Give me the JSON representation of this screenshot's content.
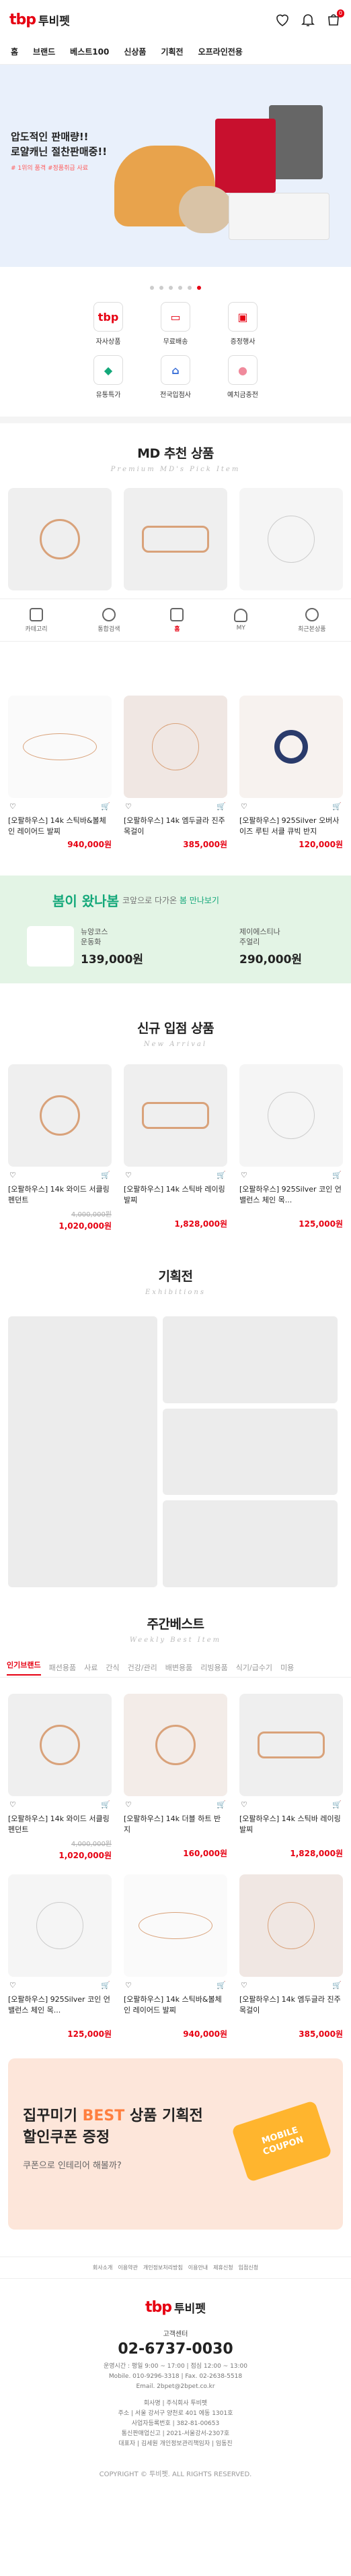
{
  "header": {
    "logo_mark": "tbp",
    "logo_text": "투비펫",
    "cart_count": "0"
  },
  "gnb": [
    "홈",
    "브랜드",
    "베스트100",
    "신상품",
    "기획전",
    "오프라인전용"
  ],
  "banner": {
    "line1": "압도적인 판매량!!",
    "line2": "로얄캐닌 절찬판매중!!",
    "tags": "# 1위의 품격 #정품취급 사료"
  },
  "quick": [
    {
      "label": "자사상품",
      "icon": "tbp-icon"
    },
    {
      "label": "무료배송",
      "icon": "truck-icon"
    },
    {
      "label": "증정행사",
      "icon": "gift-icon"
    },
    {
      "label": "유통특가",
      "icon": "tag-icon"
    },
    {
      "label": "전국입점사",
      "icon": "store-icon"
    },
    {
      "label": "예치금충전",
      "icon": "piggy-icon"
    }
  ],
  "md": {
    "title": "MD 추천 상품",
    "sub": "Premium MD's Pick Item"
  },
  "md_products": [
    {
      "name": "",
      "price": ""
    },
    {
      "name": "",
      "price": ""
    },
    {
      "name": "",
      "price": ""
    },
    {
      "name": "[오팔하우스] 14k 스틱바&볼체인 레이어드 발찌",
      "price": "940,000원"
    },
    {
      "name": "[오팔하우스] 14k 엠두글라 진주 목걸이",
      "price": "385,000원"
    },
    {
      "name": "[오팔하우스] 925Silver 오버사이즈 루틴 서클 큐빅 반지",
      "price": "120,000원"
    }
  ],
  "bottom_nav": [
    "카테고리",
    "통합검색",
    "홈",
    "MY",
    "최근본상품"
  ],
  "spring": {
    "title": "봄이 왔나봄",
    "sub_pre": "코앞으로 다가온 ",
    "sub_hl": "봄 만나보기",
    "items": [
      {
        "name": "뉴앙코스\n운동화",
        "price": "139,000원"
      },
      {
        "name": "제이에스티나\n주얼리",
        "price": "290,000원"
      }
    ]
  },
  "new": {
    "title": "신규 입점 상품",
    "sub": "New Arrival"
  },
  "new_products": [
    {
      "name": "[오팔하우스] 14k 와이드 서클링 펜던트",
      "old": "4,000,000원",
      "price": "1,020,000원"
    },
    {
      "name": "[오팔하우스] 14k 스틱바 레이링 발찌",
      "old": "",
      "price": "1,828,000원"
    },
    {
      "name": "[오팔하우스] 925Silver 코인 언밸런스 체인 목...",
      "old": "",
      "price": "125,000원"
    }
  ],
  "ex": {
    "title": "기획전",
    "sub": "Exhibitions"
  },
  "weekly": {
    "title": "주간베스트",
    "sub": "Weekly Best Item"
  },
  "weekly_tabs": [
    "인기브랜드",
    "패션용품",
    "사료",
    "간식",
    "건강/관리",
    "배변용품",
    "리빙용품",
    "식기/급수기",
    "미용"
  ],
  "weekly_products": [
    {
      "name": "[오팔하우스] 14k 와이드 서클링 펜던트",
      "old": "4,000,000원",
      "price": "1,020,000원"
    },
    {
      "name": "[오팔하우스] 14k 더블 하트 반지",
      "old": "",
      "price": "160,000원"
    },
    {
      "name": "[오팔하우스] 14k 스틱바 레이링 발찌",
      "old": "",
      "price": "1,828,000원"
    },
    {
      "name": "[오팔하우스] 925Silver 코인 언밸런스 체인 목...",
      "old": "",
      "price": "125,000원"
    },
    {
      "name": "[오팔하우스] 14k 스틱바&볼체인 레이어드 발찌",
      "old": "",
      "price": "940,000원"
    },
    {
      "name": "[오팔하우스] 14k 엠두글라 진주 목걸이",
      "old": "",
      "price": "385,000원"
    }
  ],
  "coupon": {
    "l1_pre": "집꾸미기 ",
    "l1_hl": "BEST",
    "l1_post": " 상품 기획전",
    "l2": "할인쿠폰 증정",
    "desc": "쿠폰으로 인테리어 해볼까?",
    "card": "MOBILE\nCOUPON"
  },
  "footer": {
    "links": [
      "회사소개",
      "이용약관",
      "개인정보처리방침",
      "이용안내",
      "제휴신청",
      "입점신청"
    ],
    "cs_label": "고객센터",
    "phone": "02-6737-0030",
    "hours": "운영시간 : 평일 9:00 ~ 17:00 | 점심 12:00 ~ 13:00",
    "mobile": "Mobile. 010-9296-3318 | Fax. 02-2638-5518",
    "email": "Email. 2bpet@2bpet.co.kr",
    "company": "회사명 | 주식회사 투비펫",
    "address": "주소 | 서울 강서구 양천로 401 에동 1301호",
    "bizno": "사업자등록번호 | 382-81-00653",
    "mailorder": "통신판매업신고 | 2021-서울강서-2307호",
    "ceo": "대표자 | 김세원 개인정보관리책임자 | 임동진",
    "copyright": "COPYRIGHT © 투비펫. ALL RIGHTS RESERVED."
  },
  "colors": {
    "brand": "#e60012",
    "accent_green": "#14a87a",
    "accent_orange": "#ff7f3f"
  }
}
